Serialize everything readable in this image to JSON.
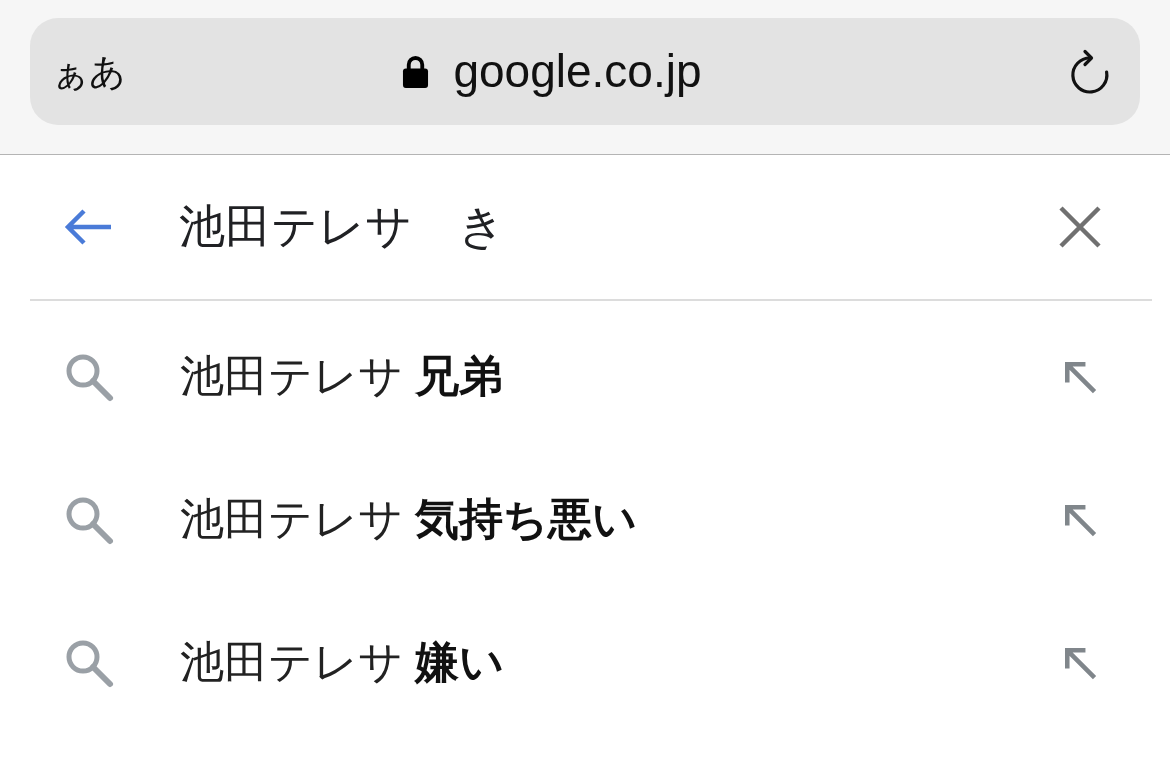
{
  "address_bar": {
    "text_size_button": "ぁあ",
    "secure": true,
    "url": "google.co.jp"
  },
  "search": {
    "value": "池田テレサ　き"
  },
  "suggestions": [
    {
      "text": "池田テレサ **兄弟**"
    },
    {
      "text": "池田テレサ **気持ち悪い**"
    },
    {
      "text": "池田テレサ **嫌い**"
    }
  ]
}
